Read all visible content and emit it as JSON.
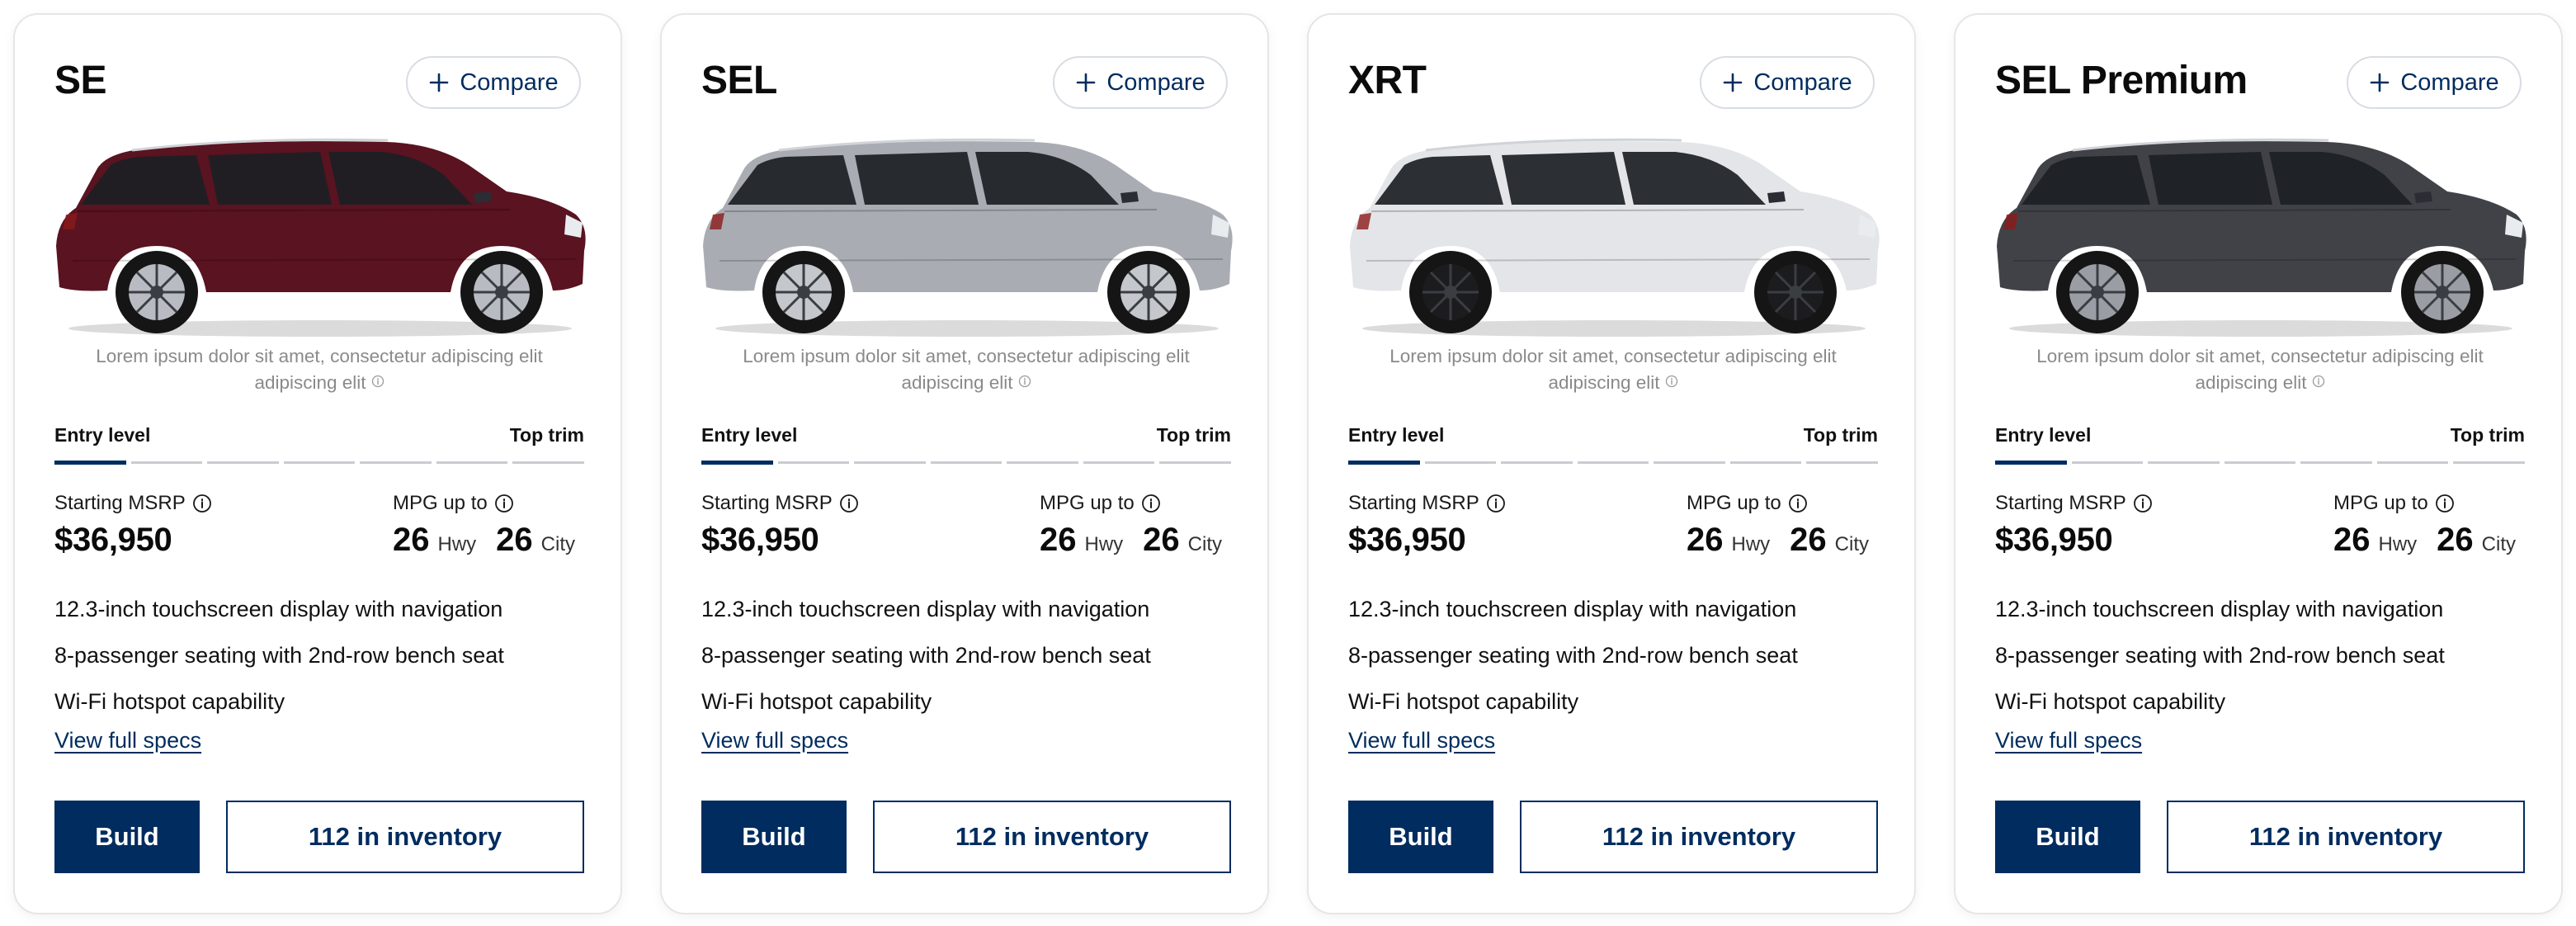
{
  "colors": {
    "brand": "#002c5f",
    "segment_inactive": "#c9ccd1",
    "muted_text": "#8a8a8a"
  },
  "icons": {
    "compare": "plus-icon",
    "info": "info-circle-icon",
    "car": "suv-side-view-image"
  },
  "cards": [
    {
      "trim": "SE",
      "compare_label": "Compare",
      "car_color": "#5a1320",
      "wheel_color": "#b8bcc2",
      "description": "Lorem ipsum dolor sit amet, consectetur adipiscing elit adipiscing elit",
      "trim_scale": {
        "low_label": "Entry level",
        "high_label": "Top trim",
        "segments": 7,
        "active_segment": 1
      },
      "msrp_label": "Starting MSRP",
      "msrp": "$36,950",
      "mpg_label": "MPG up to",
      "mpg_hwy": "26",
      "mpg_hwy_unit": "Hwy",
      "mpg_city": "26",
      "mpg_city_unit": "City",
      "features": [
        "12.3-inch touchscreen display with navigation",
        "8-passenger seating with 2nd-row bench seat",
        "Wi-Fi hotspot capability"
      ],
      "specs_link": "View full specs",
      "build_label": "Build",
      "inventory_label": "112 in inventory"
    },
    {
      "trim": "SEL",
      "compare_label": "Compare",
      "car_color": "#a9adb3",
      "wheel_color": "#c4c7cb",
      "description": "Lorem ipsum dolor sit amet, consectetur adipiscing elit adipiscing elit",
      "trim_scale": {
        "low_label": "Entry level",
        "high_label": "Top trim",
        "segments": 7,
        "active_segment": 1
      },
      "msrp_label": "Starting MSRP",
      "msrp": "$36,950",
      "mpg_label": "MPG up to",
      "mpg_hwy": "26",
      "mpg_hwy_unit": "Hwy",
      "mpg_city": "26",
      "mpg_city_unit": "City",
      "features": [
        "12.3-inch touchscreen display with navigation",
        "8-passenger seating with 2nd-row bench seat",
        "Wi-Fi hotspot capability"
      ],
      "specs_link": "View full specs",
      "build_label": "Build",
      "inventory_label": "112 in inventory"
    },
    {
      "trim": "XRT",
      "compare_label": "Compare",
      "car_color": "#e3e5e8",
      "wheel_color": "#1c1c1e",
      "description": "Lorem ipsum dolor sit amet, consectetur adipiscing elit adipiscing elit",
      "trim_scale": {
        "low_label": "Entry level",
        "high_label": "Top trim",
        "segments": 7,
        "active_segment": 1
      },
      "msrp_label": "Starting MSRP",
      "msrp": "$36,950",
      "mpg_label": "MPG up to",
      "mpg_hwy": "26",
      "mpg_hwy_unit": "Hwy",
      "mpg_city": "26",
      "mpg_city_unit": "City",
      "features": [
        "12.3-inch touchscreen display with navigation",
        "8-passenger seating with 2nd-row bench seat",
        "Wi-Fi hotspot capability"
      ],
      "specs_link": "View full specs",
      "build_label": "Build",
      "inventory_label": "112 in inventory"
    },
    {
      "trim": "SEL Premium",
      "compare_label": "Compare",
      "car_color": "#404247",
      "wheel_color": "#9a9ea4",
      "description": "Lorem ipsum dolor sit amet, consectetur adipiscing elit adipiscing elit",
      "trim_scale": {
        "low_label": "Entry level",
        "high_label": "Top trim",
        "segments": 7,
        "active_segment": 1
      },
      "msrp_label": "Starting MSRP",
      "msrp": "$36,950",
      "mpg_label": "MPG up to",
      "mpg_hwy": "26",
      "mpg_hwy_unit": "Hwy",
      "mpg_city": "26",
      "mpg_city_unit": "City",
      "features": [
        "12.3-inch touchscreen display with navigation",
        "8-passenger seating with 2nd-row bench seat",
        "Wi-Fi hotspot capability"
      ],
      "specs_link": "View full specs",
      "build_label": "Build",
      "inventory_label": "112 in inventory"
    }
  ]
}
